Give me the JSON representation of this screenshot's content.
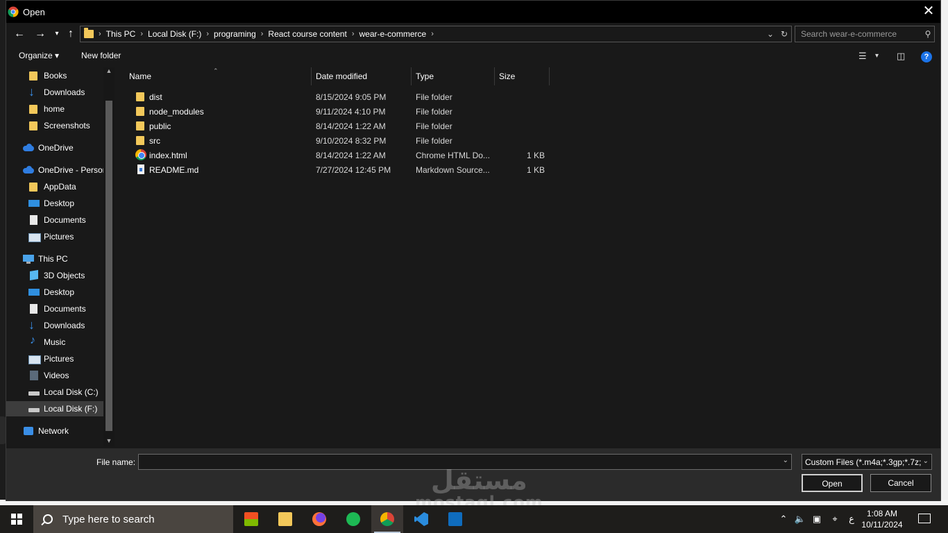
{
  "window": {
    "title": "Open"
  },
  "address": {
    "crumbs": [
      "This PC",
      "Local Disk (F:)",
      "programing",
      "React course content",
      "wear-e-commerce"
    ],
    "search_placeholder": "Search wear-e-commerce"
  },
  "toolbar": {
    "organize_label": "Organize ▾",
    "new_folder_label": "New folder",
    "help_label": "?"
  },
  "sidebar": {
    "items": [
      {
        "label": "Books",
        "icon": "folder-icon"
      },
      {
        "label": "Downloads",
        "icon": "download-icon"
      },
      {
        "label": "home",
        "icon": "folder-icon"
      },
      {
        "label": "Screenshots",
        "icon": "folder-icon"
      },
      {
        "label": "OneDrive",
        "icon": "cloud-icon"
      },
      {
        "label": "OneDrive - Persor",
        "icon": "cloud-icon"
      },
      {
        "label": "AppData",
        "icon": "folder-icon"
      },
      {
        "label": "Desktop",
        "icon": "desktop-icon"
      },
      {
        "label": "Documents",
        "icon": "document-icon"
      },
      {
        "label": "Pictures",
        "icon": "pictures-icon"
      },
      {
        "label": "This PC",
        "icon": "computer-icon"
      },
      {
        "label": "3D Objects",
        "icon": "3d-objects-icon"
      },
      {
        "label": "Desktop",
        "icon": "desktop-icon"
      },
      {
        "label": "Documents",
        "icon": "document-icon"
      },
      {
        "label": "Downloads",
        "icon": "download-icon"
      },
      {
        "label": "Music",
        "icon": "music-icon"
      },
      {
        "label": "Pictures",
        "icon": "pictures-icon"
      },
      {
        "label": "Videos",
        "icon": "video-icon"
      },
      {
        "label": "Local Disk (C:)",
        "icon": "drive-icon"
      },
      {
        "label": "Local Disk (F:)",
        "icon": "drive-icon",
        "selected": true
      },
      {
        "label": "Network",
        "icon": "network-icon"
      }
    ]
  },
  "columns": {
    "name": "Name",
    "date": "Date modified",
    "type": "Type",
    "size": "Size"
  },
  "files": [
    {
      "name": "dist",
      "date": "8/15/2024 9:05 PM",
      "type": "File folder",
      "size": "",
      "icon": "folder-icon"
    },
    {
      "name": "node_modules",
      "date": "9/11/2024 4:10 PM",
      "type": "File folder",
      "size": "",
      "icon": "folder-icon"
    },
    {
      "name": "public",
      "date": "8/14/2024 1:22 AM",
      "type": "File folder",
      "size": "",
      "icon": "folder-icon"
    },
    {
      "name": "src",
      "date": "9/10/2024 8:32 PM",
      "type": "File folder",
      "size": "",
      "icon": "folder-icon"
    },
    {
      "name": "index.html",
      "date": "8/14/2024 1:22 AM",
      "type": "Chrome HTML Do...",
      "size": "1 KB",
      "icon": "chrome-file-icon"
    },
    {
      "name": "README.md",
      "date": "7/27/2024 12:45 PM",
      "type": "Markdown Source...",
      "size": "1 KB",
      "icon": "markdown-file-icon"
    }
  ],
  "footer": {
    "file_name_label": "File name:",
    "file_name_value": "",
    "filter_value": "Custom Files (*.m4a;*.3gp;*.7z;*",
    "open_label": "Open",
    "cancel_label": "Cancel"
  },
  "watermark": {
    "arabic": "مستقل",
    "latin": "mostaql.com"
  },
  "taskbar": {
    "search_placeholder": "Type here to search",
    "apps": [
      "microsoft-store-icon",
      "file-explorer-icon",
      "firefox-icon",
      "spotify-icon",
      "chrome-icon",
      "vscode-icon",
      "outlook-icon"
    ],
    "tray_lang": "ع",
    "time": "1:08 AM",
    "date": "10/11/2024"
  },
  "colors": {
    "accent": "#1b73e8",
    "folder": "#f3c85a",
    "dialog_bg": "#191919"
  }
}
